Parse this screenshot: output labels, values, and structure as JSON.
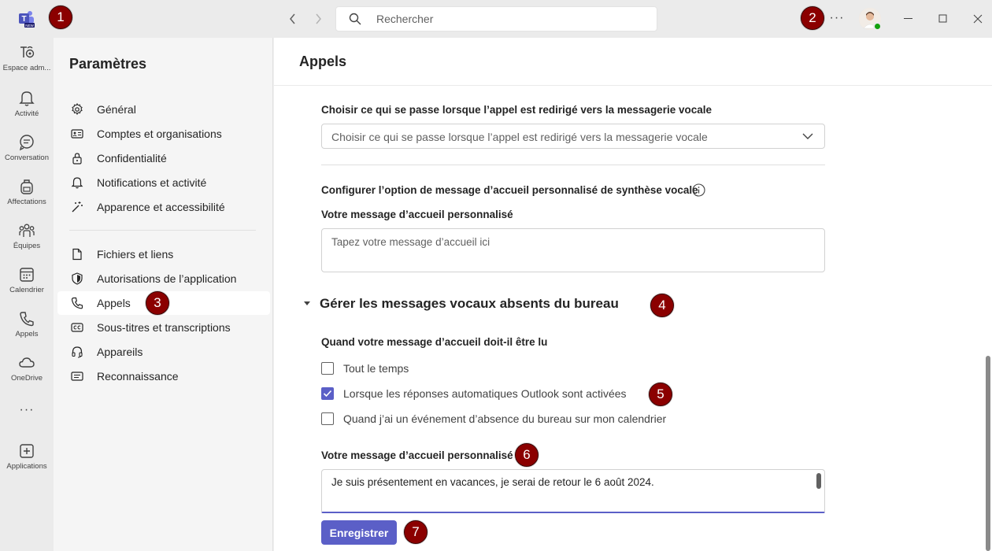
{
  "titlebar": {
    "search_placeholder": "Rechercher",
    "more_label": "···"
  },
  "badges": {
    "b1": "1",
    "b2": "2",
    "b3": "3",
    "b4": "4",
    "b5": "5",
    "b6": "6",
    "b7": "7"
  },
  "rail": {
    "items": [
      {
        "label": "Espace adm...",
        "icon": "admin-icon"
      },
      {
        "label": "Activité",
        "icon": "bell-icon"
      },
      {
        "label": "Conversation",
        "icon": "chat-icon"
      },
      {
        "label": "Affectations",
        "icon": "backpack-icon"
      },
      {
        "label": "Équipes",
        "icon": "teams-icon"
      },
      {
        "label": "Calendrier",
        "icon": "calendar-icon"
      },
      {
        "label": "Appels",
        "icon": "phone-icon"
      },
      {
        "label": "OneDrive",
        "icon": "cloud-icon"
      },
      {
        "label": "Applications",
        "icon": "add-app-icon"
      }
    ],
    "more_label": "···"
  },
  "settings": {
    "title": "Paramètres",
    "items": [
      {
        "label": "Général",
        "icon": "gear-icon"
      },
      {
        "label": "Comptes et organisations",
        "icon": "id-card-icon"
      },
      {
        "label": "Confidentialité",
        "icon": "lock-icon"
      },
      {
        "label": "Notifications et activité",
        "icon": "bell-icon"
      },
      {
        "label": "Apparence et accessibilité",
        "icon": "magic-wand-icon"
      },
      {
        "label": "Fichiers et liens",
        "icon": "file-icon"
      },
      {
        "label": "Autorisations de l’application",
        "icon": "shield-icon"
      },
      {
        "label": "Appels",
        "icon": "phone-icon"
      },
      {
        "label": "Sous-titres et transcriptions",
        "icon": "captions-icon"
      },
      {
        "label": "Appareils",
        "icon": "headset-icon"
      },
      {
        "label": "Reconnaissance",
        "icon": "recognition-icon"
      }
    ],
    "active_index": 7
  },
  "main": {
    "title": "Appels",
    "redirect_label": "Choisir ce qui se passe lorsque l’appel est redirigé vers la messagerie vocale",
    "redirect_dropdown_value": "Choisir ce qui se passe lorsque l’appel est redirigé vers la messagerie vocale",
    "tts_label": "Configurer l’option de message d’accueil personnalisé de synthèse vocale",
    "greeting_label_1": "Votre message d’accueil personnalisé",
    "greeting_placeholder_1": "Tapez votre message d’accueil ici",
    "ooo_section_title": "Gérer les messages vocaux absents du bureau",
    "when_label": "Quand votre message d’accueil doit-il être lu",
    "options": [
      {
        "label": "Tout le temps",
        "checked": false
      },
      {
        "label": "Lorsque les réponses automatiques Outlook sont activées",
        "checked": true
      },
      {
        "label": "Quand j’ai un événement d’absence du bureau sur mon calendrier",
        "checked": false
      }
    ],
    "greeting_label_2": "Votre message d’accueil personnalisé",
    "greeting_value_2": "Je suis présentement en vacances, je serai de retour le 6 août 2024.",
    "save_label": "Enregistrer"
  },
  "colors": {
    "accent": "#5b5fc7",
    "badge": "#8b0000",
    "presence": "#13a10e"
  }
}
